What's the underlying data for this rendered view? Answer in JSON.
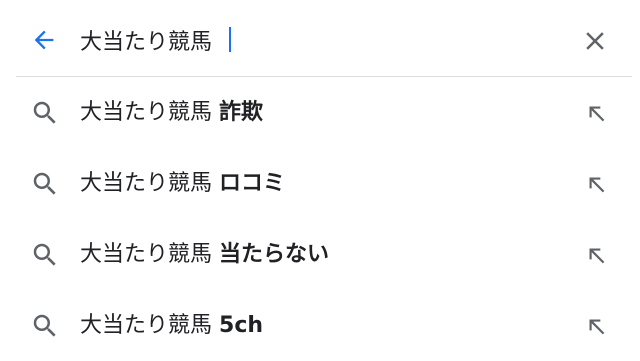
{
  "search": {
    "query": "大当たり競馬 ",
    "back_icon": "arrow-back-icon",
    "clear_icon": "close-icon"
  },
  "colors": {
    "accent": "#1a73e8",
    "icon_gray": "#5f6368",
    "text": "#202124",
    "divider": "#dadce0"
  },
  "suggestions": [
    {
      "prefix": "大当たり競馬",
      "suffix": "詐欺",
      "icon": "search-icon",
      "action_icon": "arrow-up-left-icon"
    },
    {
      "prefix": "大当たり競馬",
      "suffix": "ロコミ",
      "icon": "search-icon",
      "action_icon": "arrow-up-left-icon"
    },
    {
      "prefix": "大当たり競馬",
      "suffix": "当たらない",
      "icon": "search-icon",
      "action_icon": "arrow-up-left-icon"
    },
    {
      "prefix": "大当たり競馬",
      "suffix": "5ch",
      "icon": "search-icon",
      "action_icon": "arrow-up-left-icon"
    }
  ]
}
